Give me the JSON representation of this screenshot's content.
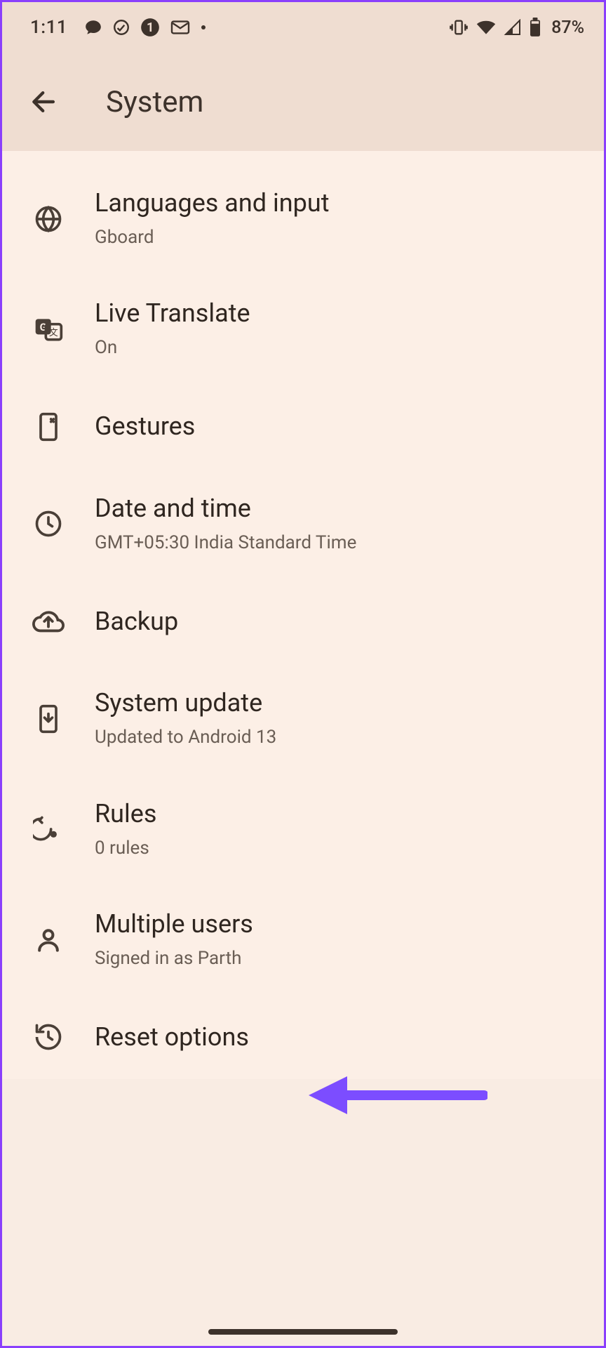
{
  "status": {
    "time": "1:11",
    "battery_pct": "87%",
    "notif_count": "1"
  },
  "header": {
    "title": "System"
  },
  "items": [
    {
      "icon": "globe",
      "title": "Languages and input",
      "sub": "Gboard"
    },
    {
      "icon": "translate",
      "title": "Live Translate",
      "sub": "On"
    },
    {
      "icon": "gestures",
      "title": "Gestures",
      "sub": ""
    },
    {
      "icon": "clock",
      "title": "Date and time",
      "sub": "GMT+05:30 India Standard Time"
    },
    {
      "icon": "backup",
      "title": "Backup",
      "sub": ""
    },
    {
      "icon": "update",
      "title": "System update",
      "sub": "Updated to Android 13"
    },
    {
      "icon": "rules",
      "title": "Rules",
      "sub": "0 rules"
    },
    {
      "icon": "users",
      "title": "Multiple users",
      "sub": "Signed in as Parth"
    },
    {
      "icon": "reset",
      "title": "Reset options",
      "sub": ""
    }
  ],
  "annotation": {
    "color": "#7c4dff"
  }
}
